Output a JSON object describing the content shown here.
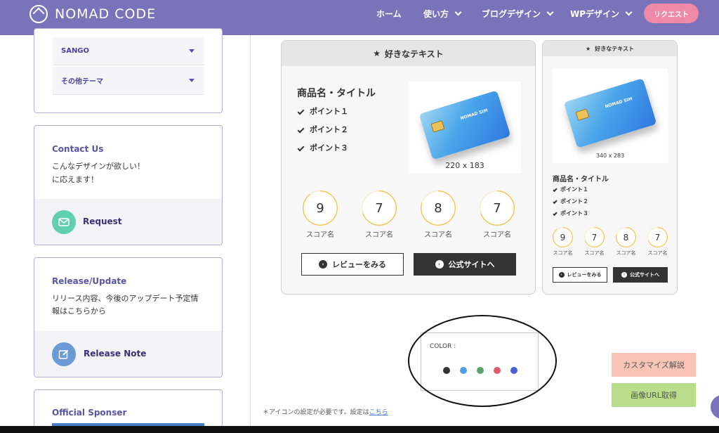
{
  "header": {
    "logo_text": "NOMAD CODE",
    "nav": [
      "ホーム",
      "使い方",
      "ブログデザイン",
      "WPデザイン"
    ],
    "request_button": "リクエスト",
    "colors": {
      "bg": "#7b73b9",
      "request": "#ee8aa8"
    }
  },
  "sidebar": {
    "accordion": [
      "SANGO",
      "その他テーマ"
    ],
    "contact": {
      "title": "Contact Us",
      "line1": "こんなデザインが欲しい！",
      "line2": "に応えます！",
      "link": "Request",
      "icon": "mail-icon",
      "icon_color": "#5fcfb0"
    },
    "release": {
      "title": "Release/Update",
      "line1": "リリース内容、今後のアップデート予定情",
      "line2": "報はこちらから",
      "link": "Release Note",
      "icon": "edit-icon",
      "icon_color": "#6a9bd5"
    },
    "sponsor": {
      "title": "Official Sponser"
    }
  },
  "product_large": {
    "header": "好きなテキスト",
    "title": "商品名・タイトル",
    "points": [
      "ポイント１",
      "ポイント２",
      "ポイント３"
    ],
    "card_brand": "NOMAD SIM",
    "image_size": "220 x 183",
    "scores": [
      {
        "value": "9",
        "label": "スコア名",
        "fraction": 0.9
      },
      {
        "value": "7",
        "label": "スコア名",
        "fraction": 0.7
      },
      {
        "value": "8",
        "label": "スコア名",
        "fraction": 0.8
      },
      {
        "value": "7",
        "label": "スコア名",
        "fraction": 0.7
      }
    ],
    "review_button": "レビューをみる",
    "official_button": "公式サイトへ"
  },
  "product_small": {
    "header": "好きなテキスト",
    "title": "商品名・タイトル",
    "points": [
      "ポイント１",
      "ポイント２",
      "ポイント３"
    ],
    "image_size": "340 x 283",
    "scores": [
      {
        "value": "9",
        "label": "スコア名",
        "fraction": 0.9
      },
      {
        "value": "7",
        "label": "スコア名",
        "fraction": 0.7
      },
      {
        "value": "8",
        "label": "スコア名",
        "fraction": 0.8
      },
      {
        "value": "7",
        "label": "スコア名",
        "fraction": 0.7
      }
    ],
    "review_button": "レビューをみる",
    "official_button": "公式サイトへ"
  },
  "color_picker": {
    "label": "COLOR :",
    "colors": [
      "#333333",
      "#4f9fe0",
      "#5aa66a",
      "#e05a6a",
      "#4b5fd6"
    ]
  },
  "note": {
    "text": "＊アイコンの設定が必要です。設定は",
    "link": "こちら"
  },
  "actions": {
    "customize": "カスタマイズ解説",
    "customize_color": "#f7c4b6",
    "get_url": "画像URL取得",
    "get_url_color": "#b9dd8a"
  }
}
